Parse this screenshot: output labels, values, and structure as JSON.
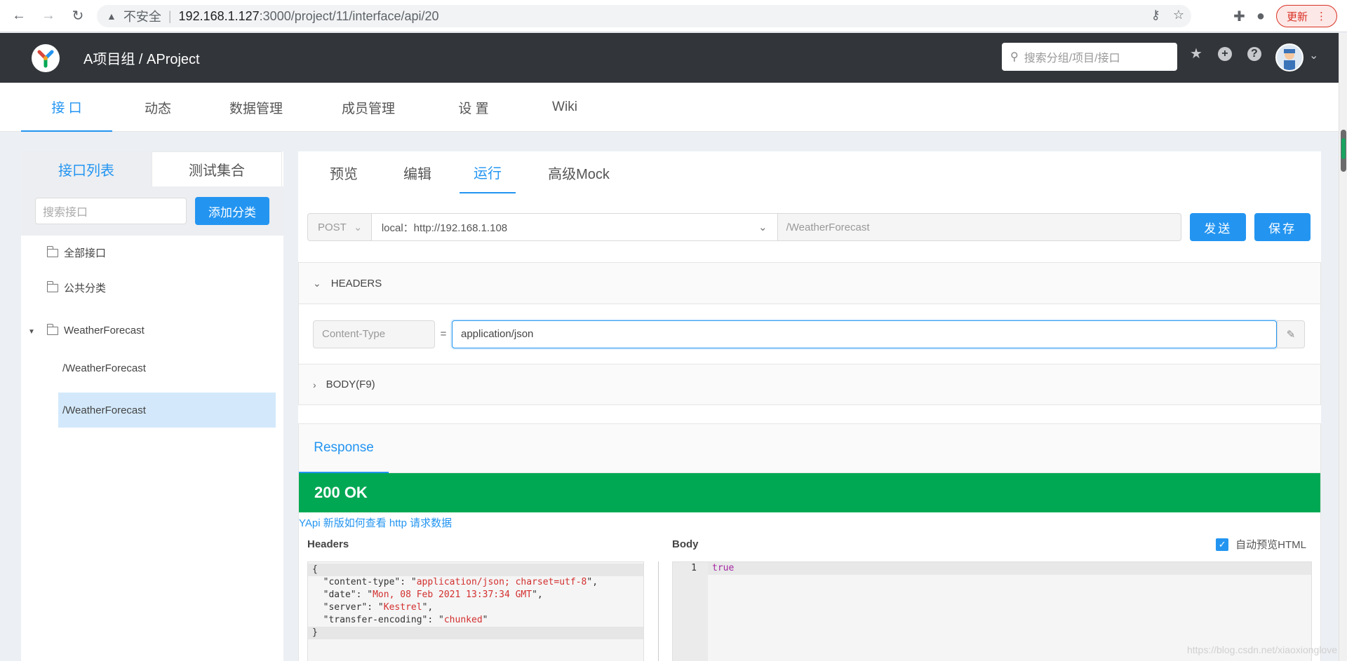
{
  "browser": {
    "insecure_label": "不安全",
    "url_host": "192.168.1.127",
    "url_path": ":3000/project/11/interface/api/20",
    "update_label": "更新"
  },
  "header": {
    "breadcrumb": "A项目组 / AProject",
    "search_placeholder": "搜索分组/项目/接口"
  },
  "subnav": {
    "tabs": [
      "接 口",
      "动态",
      "数据管理",
      "成员管理",
      "设 置",
      "Wiki"
    ]
  },
  "sidebar": {
    "tabs": [
      "接口列表",
      "测试集合"
    ],
    "search_placeholder": "搜索接口",
    "add_category_label": "添加分类",
    "items": [
      {
        "label": "全部接口"
      },
      {
        "label": "公共分类"
      },
      {
        "label": "WeatherForecast"
      }
    ],
    "leaves": [
      {
        "label": "/WeatherForecast"
      },
      {
        "label": "/WeatherForecast"
      }
    ]
  },
  "main": {
    "tabs": [
      "预览",
      "编辑",
      "运行",
      "高级Mock"
    ],
    "method": "POST",
    "env": "local：http://192.168.1.108",
    "path": "/WeatherForecast",
    "send_label": "发送",
    "save_label": "保存",
    "headers_title": "HEADERS",
    "header_key": "Content-Type",
    "header_eq": "=",
    "header_value": "application/json",
    "body_title": "BODY(F9)"
  },
  "response": {
    "tab_label": "Response",
    "status": "200 OK",
    "help_link": "YApi 新版如何查看 http 请求数据",
    "headers_label": "Headers",
    "body_label": "Body",
    "auto_preview_label": "自动预览HTML",
    "header_lines": [
      {
        "key": "content-type",
        "value": "application/json; charset=utf-8",
        "sep": ","
      },
      {
        "key": "date",
        "value": "Mon, 08 Feb 2021 13:37:34 GMT",
        "sep": ","
      },
      {
        "key": "server",
        "value": "Kestrel",
        "sep": ","
      },
      {
        "key": "transfer-encoding",
        "value": "chunked",
        "sep": ""
      }
    ],
    "body_line_number": "1",
    "body_value": "true"
  },
  "watermark": "https://blog.csdn.net/xiaoxionglove"
}
